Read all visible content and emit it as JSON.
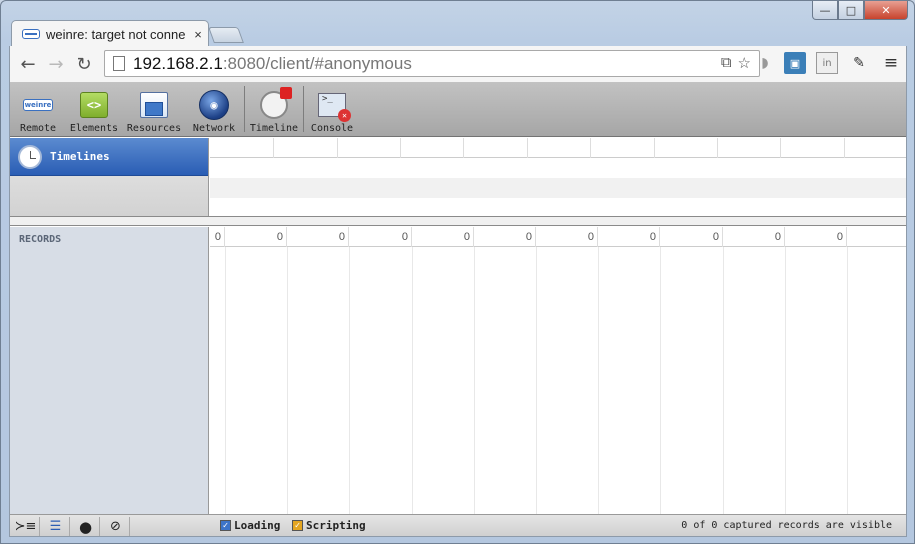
{
  "window": {
    "controls": {
      "minimize": "—",
      "maximize": "□",
      "close": "✕"
    }
  },
  "tab": {
    "title": "weinre: target not conne",
    "close": "×"
  },
  "nav": {
    "back": "←",
    "forward": "→",
    "reload": "↻"
  },
  "address": {
    "host": "192.168.2.1",
    "rest": ":8080/client/#anonymous"
  },
  "inspector": {
    "toolbar": [
      {
        "id": "remote",
        "label": "Remote",
        "icon": "weinre-remote-icon"
      },
      {
        "id": "elements",
        "label": "Elements",
        "icon": "elements-icon"
      },
      {
        "id": "resources",
        "label": "Resources",
        "icon": "resources-icon"
      },
      {
        "id": "network",
        "label": "Network",
        "icon": "network-icon"
      },
      {
        "id": "timeline",
        "label": "Timeline",
        "icon": "timeline-icon"
      },
      {
        "id": "console",
        "label": "Console",
        "icon": "console-icon"
      }
    ],
    "overview": {
      "item_label": "Timelines"
    },
    "records": {
      "header": "RECORDS",
      "ruler_values": [
        "0",
        "0",
        "0",
        "0",
        "0",
        "0",
        "0",
        "0",
        "0",
        "0",
        "0"
      ]
    },
    "statusbar": {
      "filters": [
        {
          "label": "Loading",
          "checked": true,
          "color": "#3d74c9"
        },
        {
          "label": "Scripting",
          "checked": true,
          "color": "#e4a521"
        }
      ],
      "summary": "0 of 0 captured records are visible"
    }
  }
}
